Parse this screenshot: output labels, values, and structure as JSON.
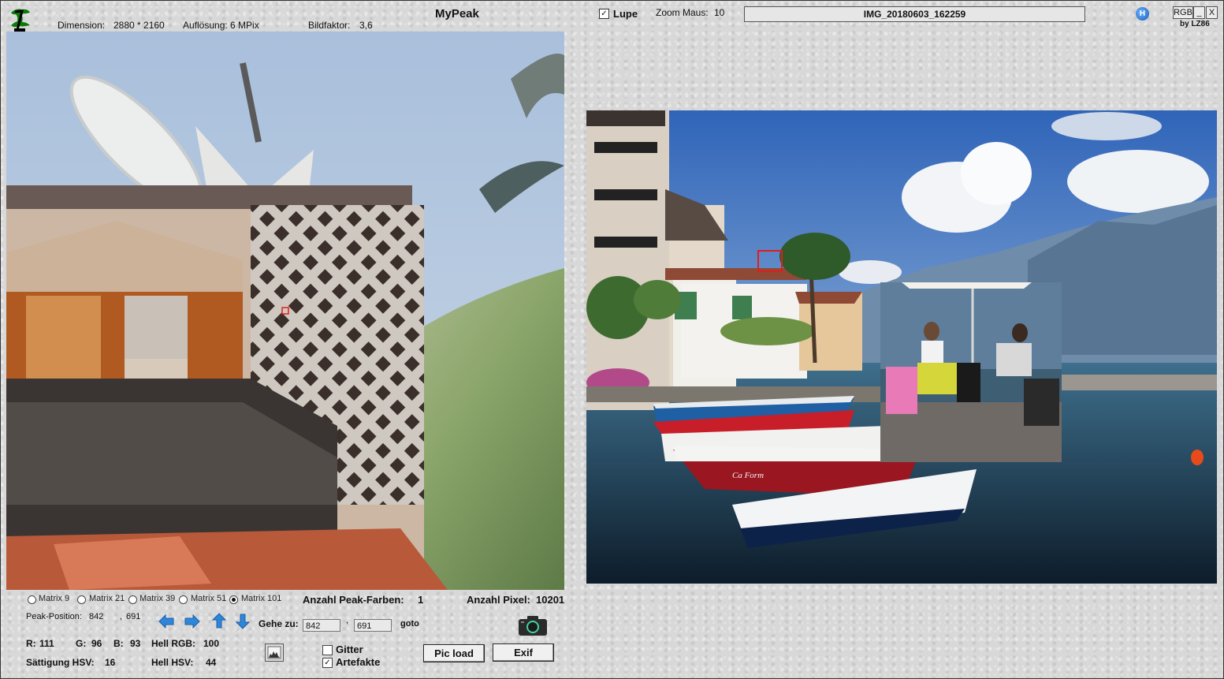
{
  "header": {
    "title": "MyPeak",
    "dimension_label": "Dimension:",
    "dimension_value": "2880 * 2160",
    "resolution": "Auflösung: 6 MPix",
    "factor_label": "Bildfaktor:",
    "factor_value": "3,6",
    "lupe_label": "Lupe",
    "lupe_checked": true,
    "zoom_label": "Zoom Maus:",
    "zoom_value": "10",
    "filename": "IMG_20180603_162259",
    "help_icon": "H",
    "rgb_button": "RGB",
    "minimize_button": "_",
    "close_button": "X",
    "credit": "by LZ86"
  },
  "matrix_options": [
    {
      "label": "Matrix 9",
      "selected": false
    },
    {
      "label": "Matrix 21",
      "selected": false
    },
    {
      "label": "Matrix 39",
      "selected": false
    },
    {
      "label": "Matrix 51",
      "selected": false
    },
    {
      "label": "Matrix 101",
      "selected": true
    }
  ],
  "stats": {
    "peak_colors_label": "Anzahl Peak-Farben:",
    "peak_colors_value": "1",
    "pixels_label": "Anzahl Pixel:",
    "pixels_value": "10201",
    "peak_position_label": "Peak-Position:",
    "peak_x": "842",
    "peak_sep": ",",
    "peak_y": "691"
  },
  "goto": {
    "label": "Gehe zu:",
    "x_value": "842",
    "sep": ",",
    "y_value": "691",
    "button": "goto"
  },
  "color_info": {
    "r_label": "R:",
    "r_value": "111",
    "g_label": "G:",
    "g_value": "96",
    "b_label": "B:",
    "b_value": "93",
    "hell_rgb_label": "Hell RGB:",
    "hell_rgb_value": "100",
    "sat_label": "Sättigung HSV:",
    "sat_value": "16",
    "hell_hsv_label": "Hell HSV:",
    "hell_hsv_value": "44"
  },
  "options": {
    "grid_label": "Gitter",
    "grid_checked": false,
    "artifacts_label": "Artefakte",
    "artifacts_checked": true
  },
  "buttons": {
    "pic_load": "Pic load",
    "exif": "Exif"
  },
  "photo": {
    "boat_text": "Ca Form"
  },
  "icons": {
    "logo": "tree-logo-icon",
    "help": "help-icon",
    "histogram": "histogram-icon",
    "camera": "camera-icon",
    "arrows": [
      "arrow-left-icon",
      "arrow-right-icon",
      "arrow-up-icon",
      "arrow-down-icon"
    ]
  }
}
